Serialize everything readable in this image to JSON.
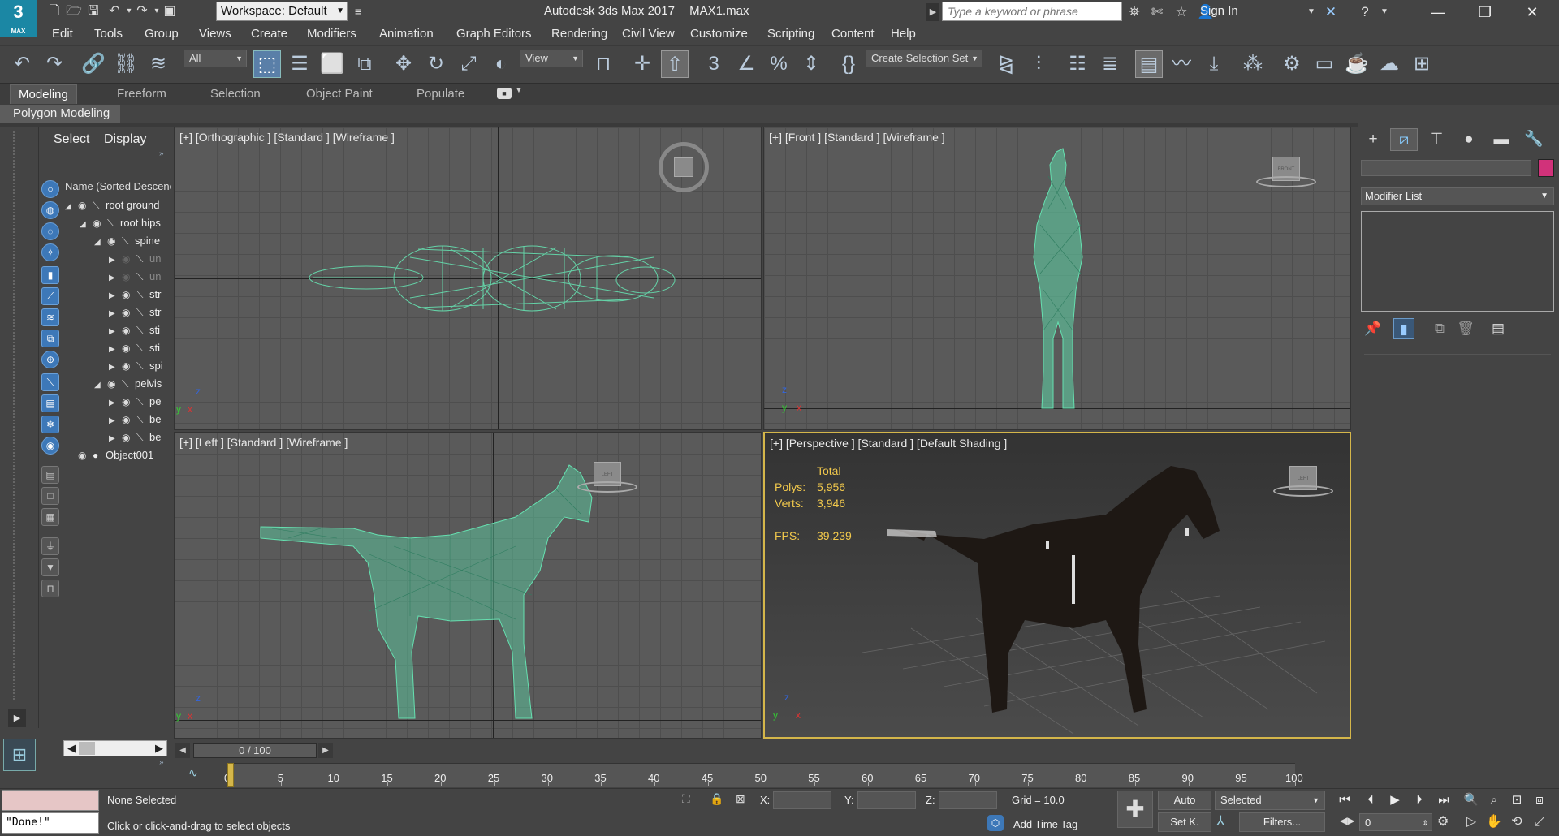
{
  "app": {
    "logo_main": "3",
    "logo_sub": "MAX",
    "title": "Autodesk 3ds Max 2017",
    "file": "MAX1.max",
    "workspace": "Workspace: Default",
    "search_placeholder": "Type a keyword or phrase",
    "sign_in": "Sign In"
  },
  "menu": [
    "Edit",
    "Tools",
    "Group",
    "Views",
    "Create",
    "Modifiers",
    "Animation",
    "Graph Editors",
    "Rendering",
    "Civil View",
    "Customize",
    "Scripting",
    "Content",
    "Help"
  ],
  "toolbar": {
    "filter": "All",
    "ref_coord": "View",
    "selection_set": "Create Selection Set"
  },
  "ribbon": {
    "tabs": [
      "Modeling",
      "Freeform",
      "Selection",
      "Object Paint",
      "Populate"
    ],
    "active_tab": "Modeling",
    "panel": "Polygon Modeling"
  },
  "scene_explorer": {
    "tabs": [
      "Select",
      "Display"
    ],
    "column_header": "Name (Sorted Descenc",
    "rows": [
      {
        "label": "root ground",
        "indent": 0,
        "expanded": true,
        "dim": false
      },
      {
        "label": "root hips",
        "indent": 1,
        "expanded": true,
        "dim": false
      },
      {
        "label": "spine",
        "indent": 2,
        "expanded": true,
        "dim": false
      },
      {
        "label": "un",
        "indent": 3,
        "expanded": false,
        "dim": true
      },
      {
        "label": "un",
        "indent": 3,
        "expanded": false,
        "dim": true
      },
      {
        "label": "str",
        "indent": 3,
        "expanded": false,
        "dim": false
      },
      {
        "label": "str",
        "indent": 3,
        "expanded": false,
        "dim": false
      },
      {
        "label": "sti",
        "indent": 3,
        "expanded": false,
        "dim": false
      },
      {
        "label": "sti",
        "indent": 3,
        "expanded": false,
        "dim": false
      },
      {
        "label": "spi",
        "indent": 3,
        "expanded": false,
        "dim": false
      },
      {
        "label": "pelvis",
        "indent": 2,
        "expanded": true,
        "dim": false
      },
      {
        "label": "pe",
        "indent": 3,
        "expanded": false,
        "dim": false
      },
      {
        "label": "be",
        "indent": 3,
        "expanded": false,
        "dim": false
      },
      {
        "label": "be",
        "indent": 3,
        "expanded": false,
        "dim": false
      },
      {
        "label": "Object001",
        "indent": 0,
        "expanded": false,
        "dim": false
      }
    ]
  },
  "viewports": {
    "top_left": "[+] [Orthographic ] [Standard ] [Wireframe ]",
    "top_right": "[+] [Front ] [Standard ] [Wireframe ]",
    "bottom_left": "[+] [Left ] [Standard ] [Wireframe ]",
    "bottom_right": "[+] [Perspective ] [Standard ] [Default Shading ]",
    "cube_front": "FRONT",
    "cube_left": "LEFT",
    "cube_persp": "LEFT",
    "stats": {
      "total_label": "Total",
      "polys_label": "Polys:",
      "polys_value": "5,956",
      "verts_label": "Verts:",
      "verts_value": "3,946",
      "fps_label": "FPS:",
      "fps_value": "39.239"
    }
  },
  "command_panel": {
    "modifier_list": "Modifier List",
    "color": "#d1327a"
  },
  "timeline": {
    "frame_display": "0 / 100",
    "ticks": [
      "0",
      "5",
      "10",
      "15",
      "20",
      "25",
      "30",
      "35",
      "40",
      "45",
      "50",
      "55",
      "60",
      "65",
      "70",
      "75",
      "80",
      "85",
      "90",
      "95",
      "100"
    ]
  },
  "status": {
    "maxscript_output": "\"Done!\"",
    "selection": "None Selected",
    "prompt": "Click or click-and-drag to select objects",
    "x_label": "X:",
    "y_label": "Y:",
    "z_label": "Z:",
    "grid": "Grid = 10.0",
    "add_time_tag": "Add Time Tag",
    "auto": "Auto",
    "set_key": "Set K.",
    "selected_dropdown": "Selected",
    "filters": "Filters...",
    "frame_value": "0"
  }
}
